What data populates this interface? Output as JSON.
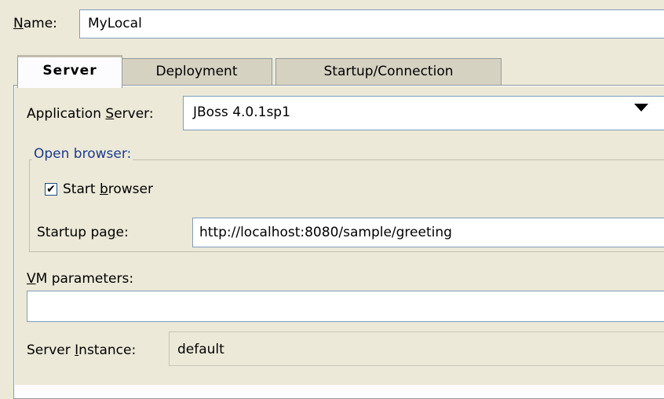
{
  "name": {
    "label_pre": "",
    "label_u": "N",
    "label_post": "ame:",
    "value": "MyLocal"
  },
  "tabs": [
    {
      "label": "Server",
      "active": true
    },
    {
      "label": "Deployment",
      "active": false
    },
    {
      "label": "Startup/Connection",
      "active": false
    }
  ],
  "server": {
    "app_server_label_pre": "Application ",
    "app_server_label_u": "S",
    "app_server_label_post": "erver:",
    "app_server_value": "JBoss 4.0.1sp1",
    "open_browser_title": "Open browser:",
    "start_browser_label_pre": "Start ",
    "start_browser_label_u": "b",
    "start_browser_label_post": "rowser",
    "start_browser_checked_mark": "✔",
    "startup_page_label_pre": "Startup pa",
    "startup_page_label_u": "g",
    "startup_page_label_post": "e:",
    "startup_page_value": "http://localhost:8080/sample/greeting",
    "vm_label_u": "V",
    "vm_label_post": "M parameters:",
    "vm_value": "",
    "instance_label_pre": "Server ",
    "instance_label_u": "I",
    "instance_label_post": "nstance:",
    "instance_value": "default"
  }
}
